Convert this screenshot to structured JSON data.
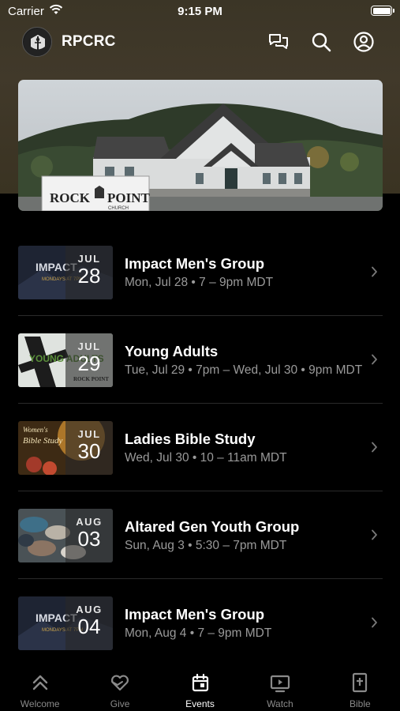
{
  "status_bar": {
    "carrier": "Carrier",
    "time": "9:15 PM"
  },
  "header": {
    "title": "RPCRC"
  },
  "hero": {
    "sign_text": "ROCK POINT",
    "sign_subtext": "CHURCH"
  },
  "events": [
    {
      "month": "JUL",
      "day": "28",
      "title": "Impact Men's Group",
      "subtitle": "Mon, Jul 28 • 7 – 9pm MDT",
      "thumb_text": "IMPACT",
      "thumb_subtext": "MONDAYS AT 7PM"
    },
    {
      "month": "JUL",
      "day": "29",
      "title": "Young Adults",
      "subtitle": "Tue, Jul 29 • 7pm – Wed, Jul 30 • 9pm MDT",
      "thumb_text": "YOUNG ADULTS",
      "thumb_subtext": "ROCK POINT"
    },
    {
      "month": "JUL",
      "day": "30",
      "title": "Ladies Bible Study",
      "subtitle": "Wed, Jul 30 • 10 – 11am MDT",
      "thumb_text": "Bible Study",
      "thumb_subtext": "Women's"
    },
    {
      "month": "AUG",
      "day": "03",
      "title": "Altared Gen Youth Group",
      "subtitle": "Sun, Aug 3 • 5:30 – 7pm MDT"
    },
    {
      "month": "AUG",
      "day": "04",
      "title": "Impact Men's Group",
      "subtitle": "Mon, Aug 4 • 7 – 9pm MDT",
      "thumb_text": "IMPACT",
      "thumb_subtext": "MONDAYS AT 7PM"
    }
  ],
  "tabs": [
    {
      "label": "Welcome",
      "icon": "double-chevron-up-icon",
      "active": false
    },
    {
      "label": "Give",
      "icon": "give-heart-icon",
      "active": false
    },
    {
      "label": "Events",
      "icon": "calendar-icon",
      "active": true
    },
    {
      "label": "Watch",
      "icon": "tv-play-icon",
      "active": false
    },
    {
      "label": "Bible",
      "icon": "bible-icon",
      "active": false
    }
  ],
  "colors": {
    "header_bg": "#3d3627",
    "background": "#000000",
    "subtitle": "#9a9a9a",
    "inactive_tab": "#8a8a8a"
  }
}
